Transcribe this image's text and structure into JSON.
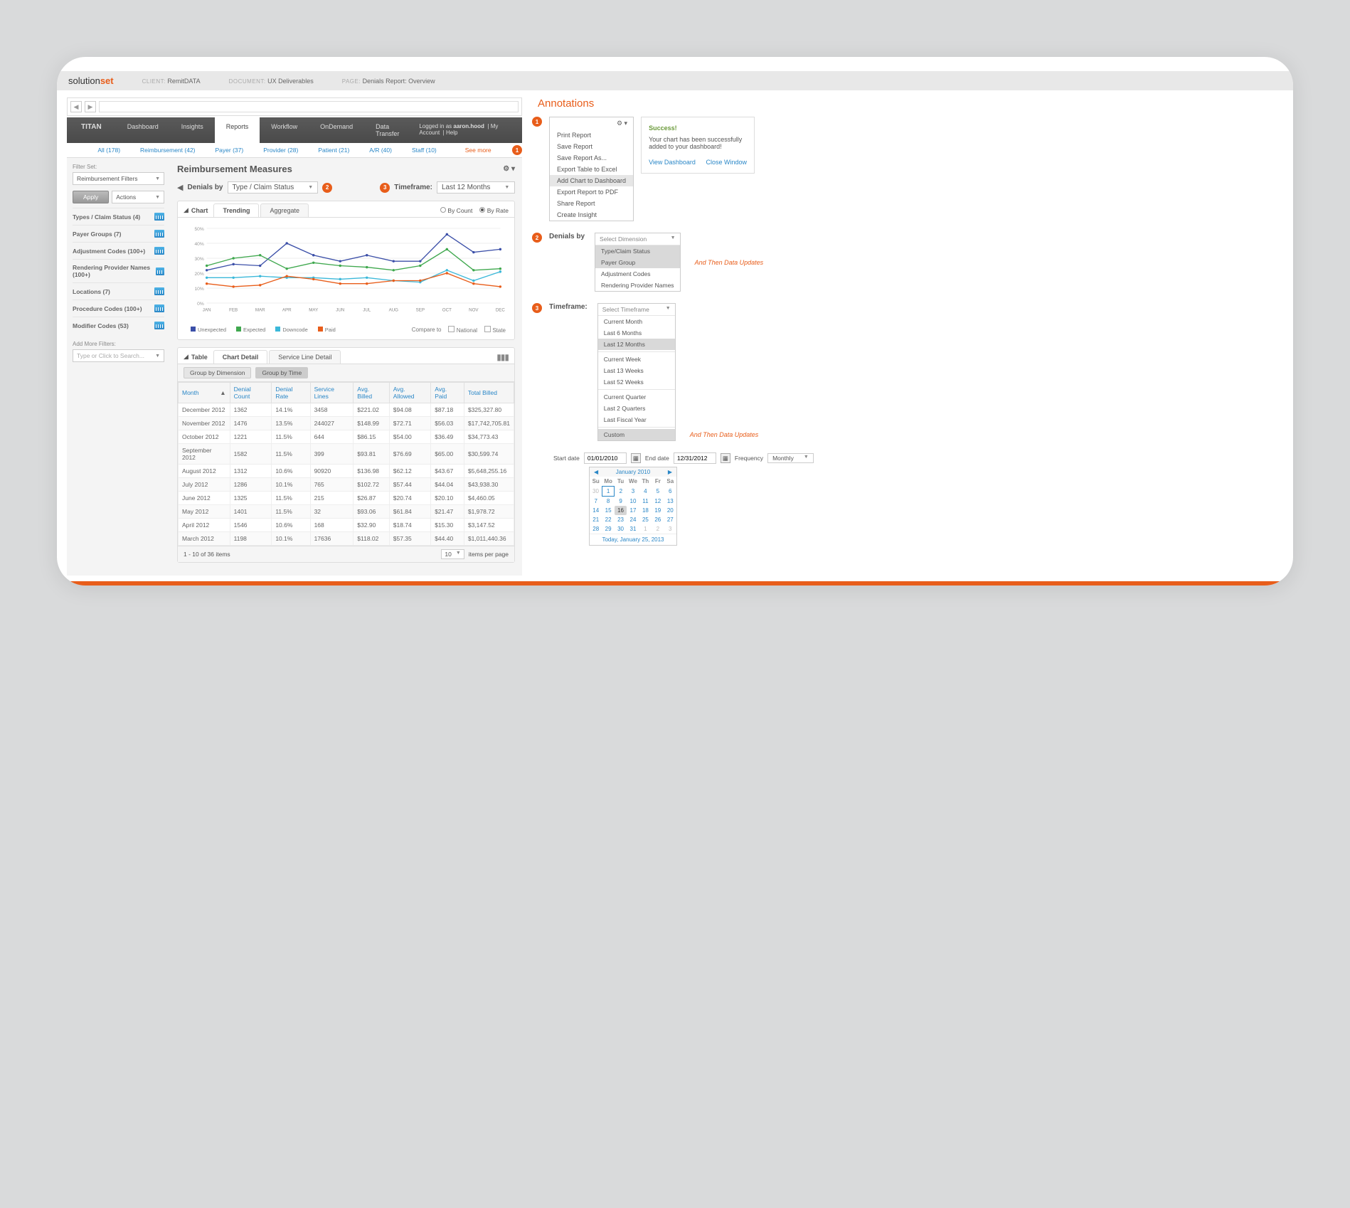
{
  "docbar": {
    "brand_a": "solution",
    "brand_b": "set",
    "client_lbl": "CLIENT:",
    "client": "RemitDATA",
    "doc_lbl": "DOCUMENT:",
    "doc": "UX Deliverables",
    "page_lbl": "PAGE:",
    "page": "Denials Report: Overview"
  },
  "topnav": {
    "logo": "TITAN",
    "tabs": [
      "Dashboard",
      "Insights",
      "Reports",
      "Workflow",
      "OnDemand",
      "Data Transfer"
    ],
    "active": 2,
    "login_pre": "Logged in as ",
    "login_user": "aaron.hood",
    "links": [
      "My Account",
      "Help"
    ]
  },
  "subnav": [
    "All (178)",
    "Reimbursement (42)",
    "Payer (37)",
    "Provider (28)",
    "Patient (21)",
    "A/R (40)",
    "Staff (10)"
  ],
  "subnav_more": "See more",
  "page_title": "Reimbursement Measures",
  "sidebar": {
    "filter_set_lbl": "Filter Set:",
    "filter_set_val": "Reimbursement Filters",
    "apply": "Apply",
    "actions": "Actions",
    "filters": [
      "Types / Claim Status (4)",
      "Payer Groups (7)",
      "Adjustment Codes (100+)",
      "Rendering Provider Names (100+)",
      "Locations (7)",
      "Procedure Codes (100+)",
      "Modifier Codes (53)"
    ],
    "more_lbl": "Add More Filters:",
    "more_ph": "Type or Click to Search..."
  },
  "dim": {
    "denials_lbl": "Denials by",
    "denials_val": "Type / Claim Status",
    "tf_lbl": "Timeframe:",
    "tf_val": "Last 12 Months"
  },
  "chart_panel": {
    "title": "Chart",
    "tabs": [
      "Trending",
      "Aggregate"
    ],
    "radio": [
      "By Count",
      "By Rate"
    ],
    "radio_sel": 1,
    "legend": [
      "Unexpected",
      "Expected",
      "Downcode",
      "Paid"
    ],
    "compare_lbl": "Compare to",
    "compare": [
      "National",
      "State"
    ]
  },
  "chart_data": {
    "type": "line",
    "categories": [
      "JAN",
      "FEB",
      "MAR",
      "APR",
      "MAY",
      "JUN",
      "JUL",
      "AUG",
      "SEP",
      "OCT",
      "NOV",
      "DEC"
    ],
    "ylabel": "%",
    "ylim": [
      0,
      50
    ],
    "yticks": [
      0,
      10,
      20,
      30,
      40,
      50
    ],
    "series": [
      {
        "name": "Unexpected",
        "color": "#3b4fa8",
        "values": [
          22,
          26,
          25,
          40,
          32,
          28,
          32,
          28,
          28,
          46,
          34,
          36
        ]
      },
      {
        "name": "Expected",
        "color": "#3fa84e",
        "values": [
          25,
          30,
          32,
          23,
          27,
          25,
          24,
          22,
          25,
          36,
          22,
          23
        ]
      },
      {
        "name": "Downcode",
        "color": "#3bb8d9",
        "values": [
          17,
          17,
          18,
          17,
          17,
          16,
          17,
          15,
          14,
          22,
          15,
          21
        ]
      },
      {
        "name": "Paid",
        "color": "#e85d1a",
        "values": [
          13,
          11,
          12,
          18,
          16,
          13,
          13,
          15,
          15,
          20,
          13,
          11
        ]
      }
    ]
  },
  "table_panel": {
    "title": "Table",
    "tabs": [
      "Chart Detail",
      "Service Line Detail"
    ],
    "group_btns": [
      "Group by Dimension",
      "Group by Time"
    ],
    "group_sel": 1,
    "cols": [
      "Month",
      "Denial Count",
      "Denial Rate",
      "Service Lines",
      "Avg. Billed",
      "Avg. Allowed",
      "Avg. Paid",
      "Total Billed"
    ],
    "rows": [
      [
        "December 2012",
        "1362",
        "14.1%",
        "3458",
        "$221.02",
        "$94.08",
        "$87.18",
        "$325,327.80"
      ],
      [
        "November 2012",
        "1476",
        "13.5%",
        "244027",
        "$148.99",
        "$72.71",
        "$56.03",
        "$17,742,705.81"
      ],
      [
        "October 2012",
        "1221",
        "11.5%",
        "644",
        "$86.15",
        "$54.00",
        "$36.49",
        "$34,773.43"
      ],
      [
        "September 2012",
        "1582",
        "11.5%",
        "399",
        "$93.81",
        "$76.69",
        "$65.00",
        "$30,599.74"
      ],
      [
        "August 2012",
        "1312",
        "10.6%",
        "90920",
        "$136.98",
        "$62.12",
        "$43.67",
        "$5,648,255.16"
      ],
      [
        "July 2012",
        "1286",
        "10.1%",
        "765",
        "$102.72",
        "$57.44",
        "$44.04",
        "$43,938.30"
      ],
      [
        "June 2012",
        "1325",
        "11.5%",
        "215",
        "$26.87",
        "$20.74",
        "$20.10",
        "$4,460.05"
      ],
      [
        "May 2012",
        "1401",
        "11.5%",
        "32",
        "$93.06",
        "$61.84",
        "$21.47",
        "$1,978.72"
      ],
      [
        "April 2012",
        "1546",
        "10.6%",
        "168",
        "$32.90",
        "$18.74",
        "$15.30",
        "$3,147.52"
      ],
      [
        "March 2012",
        "1198",
        "10.1%",
        "17636",
        "$118.02",
        "$57.35",
        "$44.40",
        "$1,011,440.36"
      ]
    ],
    "pager_txt": "1 - 10 of 36 items",
    "per_lbl": "items per page",
    "per_val": "10"
  },
  "annotations": {
    "title": "Annotations",
    "gear_menu": [
      "Print Report",
      "Save Report",
      "Save Report As...",
      "Export Table to Excel",
      "Add Chart to Dashboard",
      "Export Report to PDF",
      "Share Report",
      "Create Insight"
    ],
    "gear_sel": 4,
    "toast": {
      "title": "Success!",
      "body": "Your chart has been successfully added to your dashboard!",
      "view": "View Dashboard",
      "close": "Close Window"
    },
    "denials_lbl": "Denials by",
    "denials_dd": {
      "placeholder": "Select Dimension",
      "opts": [
        "Type/Claim Status",
        "Payer Group",
        "Adjustment Codes",
        "Rendering Provider Names"
      ],
      "sel": 0
    },
    "note": "And Then Data Updates",
    "tf_lbl": "Timeframe:",
    "tf_dd": {
      "placeholder": "Select Timeframe",
      "groups": [
        [
          "Current Month",
          "Last 6 Months",
          "Last 12 Months"
        ],
        [
          "Current Week",
          "Last 13 Weeks",
          "Last 52 Weeks"
        ],
        [
          "Current Quarter",
          "Last 2 Quarters",
          "Last Fiscal Year"
        ],
        [
          "Custom"
        ]
      ],
      "sel": "Last 12 Months",
      "sel2": "Custom"
    },
    "daterow": {
      "start_lbl": "Start date",
      "start": "01/01/2010",
      "end_lbl": "End date",
      "end": "12/31/2012",
      "freq_lbl": "Frequency",
      "freq": "Monthly"
    },
    "cal": {
      "month": "January 2010",
      "days": [
        "Su",
        "Mo",
        "Tu",
        "We",
        "Th",
        "Fr",
        "Sa"
      ],
      "foot": "Today, January 25, 2013"
    }
  }
}
